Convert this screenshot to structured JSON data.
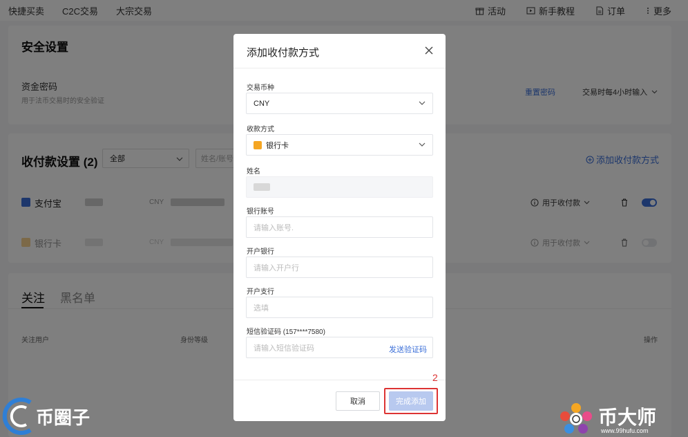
{
  "topnav": {
    "left": [
      "快捷买卖",
      "C2C交易",
      "大宗交易"
    ],
    "right": [
      {
        "icon": "gift-icon",
        "label": "活动"
      },
      {
        "icon": "play-icon",
        "label": "新手教程"
      },
      {
        "icon": "document-icon",
        "label": "订单"
      },
      {
        "icon": "more-icon",
        "label": "更多"
      }
    ]
  },
  "security": {
    "title": "安全设置",
    "fund_password": "资金密码",
    "fund_password_desc": "用于法币交易时的安全验证",
    "reset_password": "重置密码",
    "frequency": "交易时每4小时输入"
  },
  "payments": {
    "title": "收付款设置 (2)",
    "filter": "全部",
    "search_placeholder": "姓名/账号",
    "add_link": "添加收付款方式",
    "rows": [
      {
        "name": "支付宝",
        "currency": "CNY",
        "usage": "用于收付款"
      },
      {
        "name": "银行卡",
        "currency": "CNY",
        "usage": "用于收付款"
      }
    ]
  },
  "follow": {
    "tabs": [
      "关注",
      "黑名单"
    ],
    "col_user": "关注用户",
    "col_level": "身份等级",
    "col_action": "操作"
  },
  "modal": {
    "title": "添加收付款方式",
    "currency_label": "交易币种",
    "currency_value": "CNY",
    "method_label": "收款方式",
    "method_value": "银行卡",
    "name_label": "姓名",
    "account_label": "银行账号",
    "account_placeholder": "请输入账号.",
    "bank_label": "开户银行",
    "bank_placeholder": "请输入开户行",
    "branch_label": "开户支行",
    "branch_placeholder": "选填",
    "sms_label": "短信验证码 (157****7580)",
    "sms_placeholder": "请输入短信验证码",
    "send_code": "发送验证码",
    "cancel": "取消",
    "submit": "完成添加"
  },
  "annotation": {
    "step": "2"
  },
  "watermarks": {
    "left": "币圈子",
    "right": "币大师",
    "right_url": "www.99hufu.com"
  },
  "colors": {
    "accent": "#3b6fd8",
    "highlight": "#dd3333",
    "alipay": "#3b6fd8",
    "bankcard": "#f5a623"
  }
}
